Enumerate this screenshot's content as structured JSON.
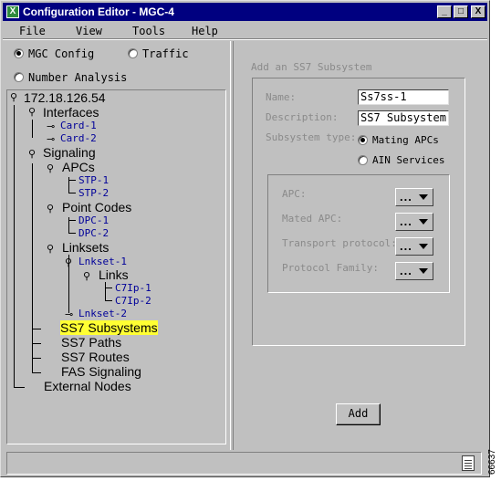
{
  "window": {
    "title": "Configuration Editor - MGC-4",
    "app_icon_letter": "X",
    "minimize_glyph": "_",
    "maximize_glyph": "□",
    "close_glyph": "X"
  },
  "menubar": {
    "items": [
      "File",
      "View",
      "Tools",
      "Help"
    ]
  },
  "view_mode": {
    "options": [
      {
        "label": "MGC Config",
        "selected": true
      },
      {
        "label": "Traffic",
        "selected": false
      },
      {
        "label": "Number Analysis",
        "selected": false
      }
    ]
  },
  "tree": {
    "root": "172.18.126.54",
    "interfaces": "Interfaces",
    "card1": "Card-1",
    "card2": "Card-2",
    "signaling": "Signaling",
    "apcs": "APCs",
    "stp1": "STP-1",
    "stp2": "STP-2",
    "point_codes": "Point Codes",
    "dpc1": "DPC-1",
    "dpc2": "DPC-2",
    "linksets": "Linksets",
    "lnkset1": "Lnkset-1",
    "links": "Links",
    "c7lp1": "C7Ip-1",
    "c7lp2": "C7Ip-2",
    "lnkset2": "Lnkset-2",
    "ss7_subsystems": "SS7 Subsystems",
    "ss7_paths": "SS7 Paths",
    "ss7_routes": "SS7 Routes",
    "fas_signaling": "FAS Signaling",
    "external_nodes": "External Nodes"
  },
  "form": {
    "heading": "Add an SS7 Subsystem",
    "name_label": "Name:",
    "name_value": "Ss7ss-1",
    "description_label": "Description:",
    "description_value": "SS7 Subsystem",
    "subsystem_type_label": "Subsystem type:",
    "subsystem_type_options": [
      {
        "label": "Mating APCs",
        "selected": true
      },
      {
        "label": "AIN Services",
        "selected": false
      }
    ],
    "apc_label": "APC:",
    "mated_apc_label": "Mated APC:",
    "transport_protocol_label": "Transport protocol:",
    "protocol_family_label": "Protocol Family:",
    "combo_placeholder": "...",
    "add_button": "Add"
  },
  "statusbar": {
    "text": ""
  },
  "figure_id": "66637"
}
